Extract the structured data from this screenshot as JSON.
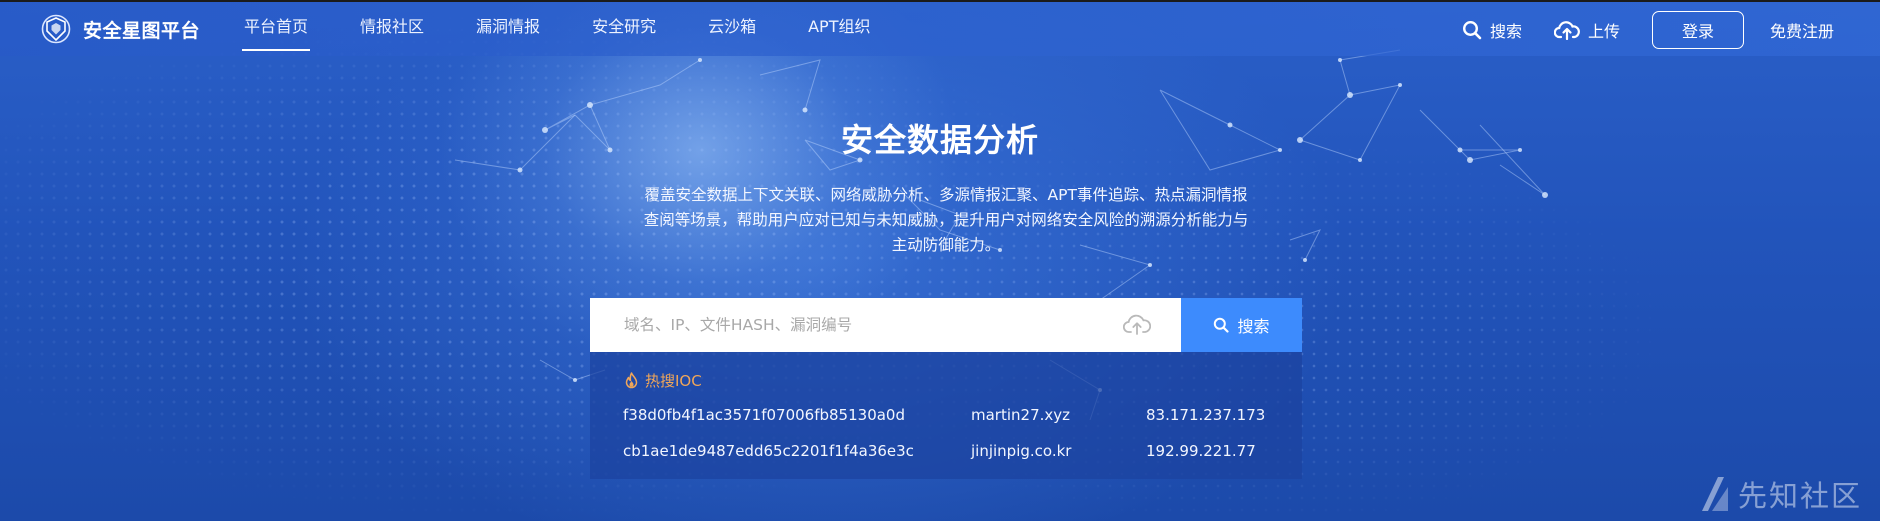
{
  "brand": {
    "name": "安全星图平台"
  },
  "nav": {
    "items": [
      {
        "label": "平台首页",
        "active": true
      },
      {
        "label": "情报社区",
        "active": false
      },
      {
        "label": "漏洞情报",
        "active": false
      },
      {
        "label": "安全研究",
        "active": false
      },
      {
        "label": "云沙箱",
        "active": false
      },
      {
        "label": "APT组织",
        "active": false
      }
    ],
    "search_label": "搜索",
    "upload_label": "上传",
    "login_label": "登录",
    "register_label": "免费注册"
  },
  "hero": {
    "title": "安全数据分析",
    "description": "覆盖安全数据上下文关联、网络威胁分析、多源情报汇聚、APT事件追踪、热点漏洞情报查阅等场景，帮助用户应对已知与未知威胁，提升用户对网络安全风险的溯源分析能力与主动防御能力。"
  },
  "search": {
    "placeholder": "域名、IP、文件HASH、漏洞编号",
    "button_label": "搜索"
  },
  "hot_ioc": {
    "title": "热搜IOC",
    "rows": [
      {
        "hash": "f38d0fb4f1ac3571f07006fb85130a0d",
        "domain": "martin27.xyz",
        "ip": "83.171.237.173"
      },
      {
        "hash": "cb1ae1de9487edd65c2201f1f4a36e3c",
        "domain": "jinjinpig.co.kr",
        "ip": "192.99.221.77"
      }
    ]
  },
  "watermark": {
    "text": "先知社区"
  },
  "colors": {
    "background": "#2254bb",
    "search_button": "#3d8bfd",
    "hot_title": "#f0a659"
  },
  "icons": [
    "logo-icon",
    "search-icon",
    "upload-cloud-icon",
    "fire-icon",
    "watermark-logo-icon"
  ]
}
